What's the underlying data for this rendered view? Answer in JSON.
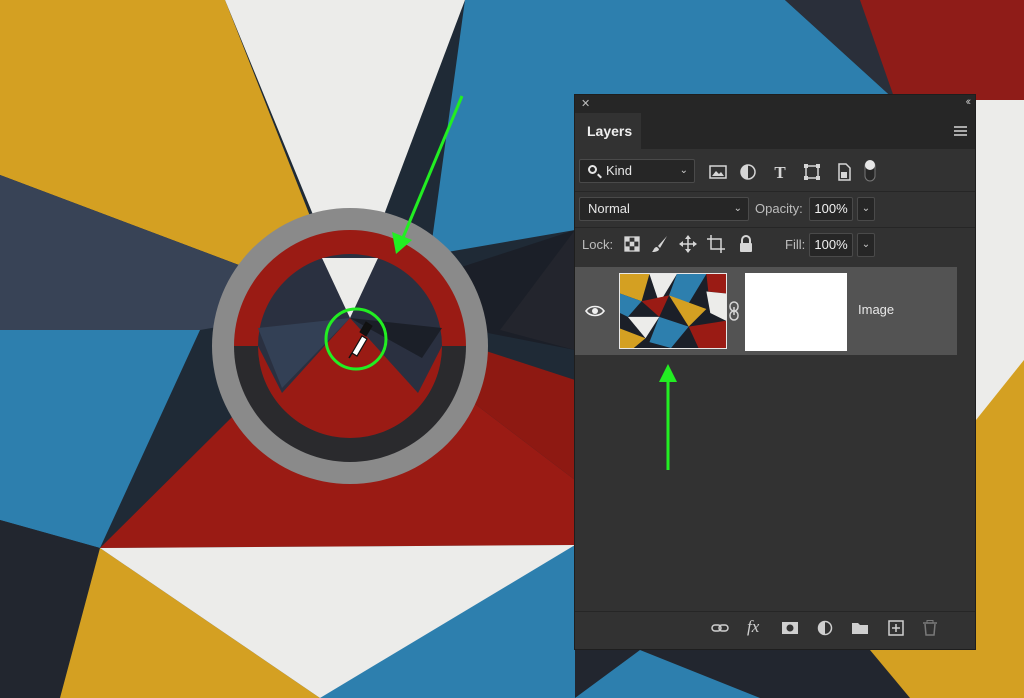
{
  "layers_panel": {
    "title": "Layers",
    "filter": {
      "selected": "Kind",
      "icons": [
        "image-filter-icon",
        "adjustment-filter-icon",
        "type-filter-icon",
        "shape-filter-icon",
        "smart-object-filter-icon",
        "filter-toggle-icon"
      ]
    },
    "blend_mode": "Normal",
    "opacity_label": "Opacity:",
    "opacity_value": "100%",
    "lock_label": "Lock:",
    "lock_icons": [
      "lock-transparent-pixels-icon",
      "lock-image-pixels-icon",
      "lock-position-icon",
      "lock-artboard-icon",
      "lock-all-icon"
    ],
    "fill_label": "Fill:",
    "fill_value": "100%",
    "layers": [
      {
        "name": "Image",
        "visible": true,
        "has_mask": true
      }
    ],
    "bottom_icons": [
      "link-layers-icon",
      "fx-icon",
      "add-mask-icon",
      "adjustment-layer-icon",
      "group-folder-icon",
      "new-layer-icon",
      "trash-icon"
    ],
    "fx_label": "fx"
  },
  "annotations": {
    "arrow_color": "#22ee22"
  },
  "colors": {
    "sampled_top": "#9a1b14",
    "sampled_bottom": "#2a2a2d",
    "ring": "#8a8a8a",
    "panel_bg": "#323232",
    "layer_selected_bg": "#535353"
  }
}
